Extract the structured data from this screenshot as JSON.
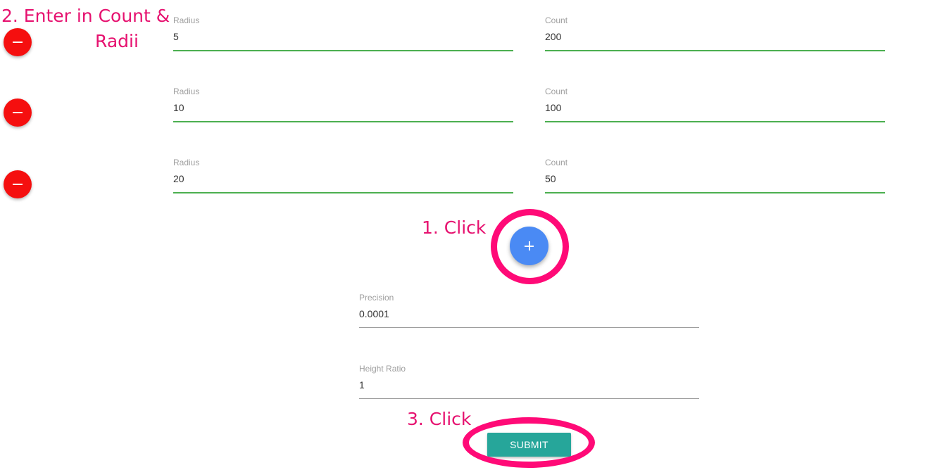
{
  "annotations": {
    "step2_line1": "2. Enter in Count &",
    "step2_line2": "Radii",
    "step1": "1. Click",
    "step3": "3. Click",
    "ring_color": "#ff0a77",
    "text_color": "#e6116f"
  },
  "rows": [
    {
      "radius": {
        "label": "Radius",
        "value": "5"
      },
      "count": {
        "label": "Count",
        "value": "200"
      },
      "remove_icon": "minus-icon"
    },
    {
      "radius": {
        "label": "Radius",
        "value": "10"
      },
      "count": {
        "label": "Count",
        "value": "100"
      },
      "remove_icon": "minus-icon"
    },
    {
      "radius": {
        "label": "Radius",
        "value": "20"
      },
      "count": {
        "label": "Count",
        "value": "50"
      },
      "remove_icon": "minus-icon"
    }
  ],
  "add_button": {
    "icon": "plus-icon",
    "color": "#4a8af4"
  },
  "remove_button_color": "#f50f0f",
  "valid_field_color": "#4caf50",
  "precision": {
    "label": "Precision",
    "value": "0.0001"
  },
  "height_ratio": {
    "label": "Height Ratio",
    "value": "1"
  },
  "submit": {
    "label": "SUBMIT",
    "color": "#26a69a"
  }
}
